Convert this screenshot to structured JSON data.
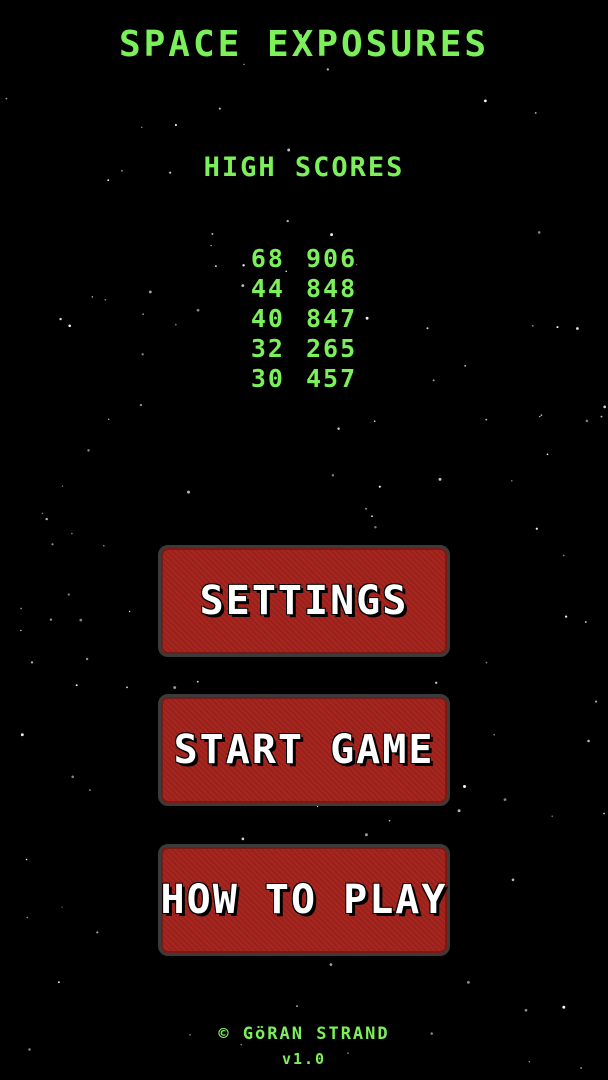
{
  "game": {
    "title": "SPACE EXPOSURES"
  },
  "high_scores": {
    "heading": "HIGH SCORES",
    "scores": [
      "68 906",
      "44 848",
      "40 847",
      "32 265",
      "30 457"
    ]
  },
  "menu": {
    "settings_label": "SETTINGS",
    "start_game_label": "START GAME",
    "how_to_play_label": "HOW TO PLAY"
  },
  "footer": {
    "credit": "© GöRAN STRAND",
    "version": "v1.0"
  },
  "colors": {
    "background": "#000000",
    "text_green": "#7CF05A",
    "button_red": "#A8261F",
    "button_border": "#3B3B3B",
    "button_text": "#FFFFFF"
  }
}
